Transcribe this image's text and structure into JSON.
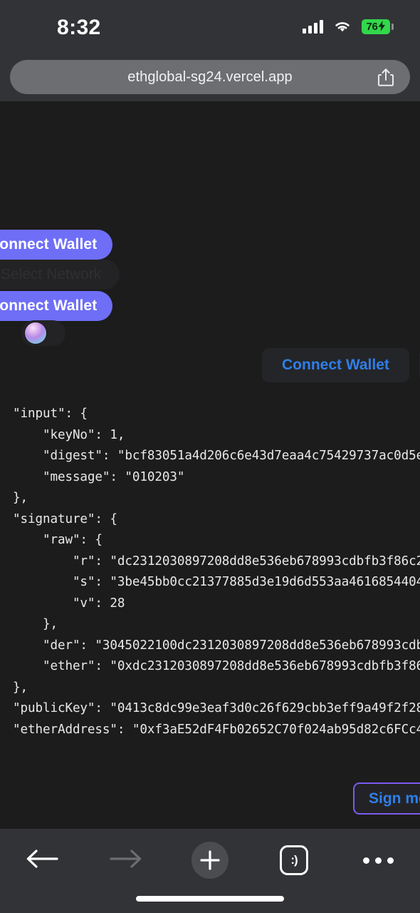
{
  "statusbar": {
    "time": "8:32",
    "battery_percent": "76",
    "battery_bolt": "⚡",
    "signal_icon": "cellular-signal-icon",
    "wifi_icon": "wifi-icon",
    "battery_icon": "battery-charging-icon"
  },
  "browser": {
    "url": "ethglobal-sg24.vercel.app",
    "share_icon": "share-icon"
  },
  "page": {
    "connect_wallet_primary_1": "Connect Wallet",
    "connect_wallet_primary_2": "Connect Wallet",
    "select_network": "Select Network",
    "network_icon": "network-hub-icon",
    "avatar_icon": "wallet-avatar-sphere",
    "connect_wallet_chip_1": "Connect Wallet",
    "connect_wallet_chip_2": "C",
    "sign_button": "Sign me",
    "colors": {
      "accent_purple": "#6e6ef7",
      "link_blue": "#2f7fe8",
      "outline_violet": "#7b5cf0",
      "page_bg": "#1c1c1c",
      "chrome_bg": "#323336",
      "battery_green": "#32d74b"
    },
    "json_output": "\"input\": {\n    \"keyNo\": 1,\n    \"digest\": \"bcf83051a4d206c6e43d7eaa4c75429737ac0d5ee08ee684304\n    \"message\": \"010203\"\n},\n\"signature\": {\n    \"raw\": {\n        \"r\": \"dc2312030897208dd8e536eb678993cdbfb3f86c29dbf457ae81\n        \"s\": \"3be45bb0cc21377885d3e19d6d553aa4616854404cb9b7e5bdc1\n        \"v\": 28\n    },\n    \"der\": \"3045022100dc2312030897208dd8e536eb678993cdbfb3f86c29db\n    \"ether\": \"0xdc2312030897208dd8e536eb678993cdbfb3f86c29dbf457ae\n},\n\"publicKey\": \"0413c8dc99e3eaf3d0c26f629cbb3eff9a49f2f28d907fb013ee\n\"etherAddress\": \"0xf3aE52dF4Fb02652C70f024ab95d82c6FCc4258c\""
  },
  "toolbar": {
    "back_icon": "arrow-left-icon",
    "forward_icon": "arrow-right-icon",
    "add_icon": "plus-icon",
    "tabs_icon": "smiley-tabs-icon",
    "tabs_glyph": ":)",
    "more_icon": "ellipsis-icon"
  }
}
